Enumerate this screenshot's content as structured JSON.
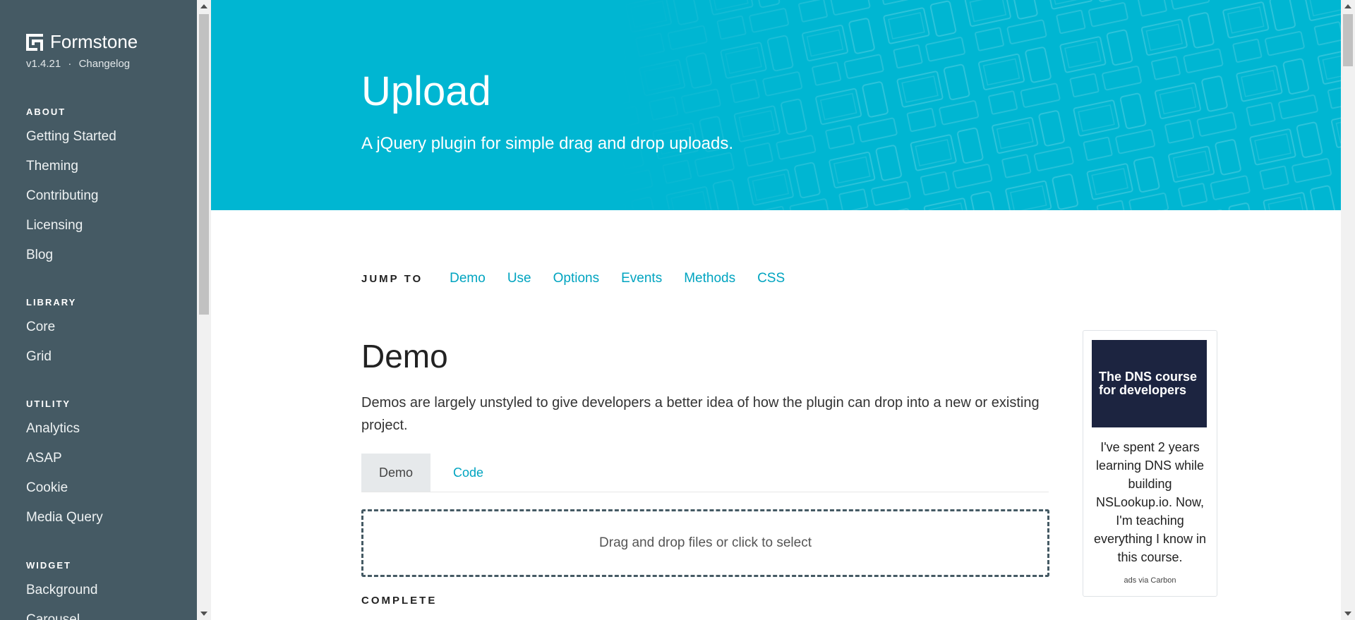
{
  "sidebar": {
    "brand": "Formstone",
    "version": "v1.4.21",
    "separator": "·",
    "changelog": "Changelog",
    "sections": [
      {
        "heading": "ABOUT",
        "items": [
          "Getting Started",
          "Theming",
          "Contributing",
          "Licensing",
          "Blog"
        ]
      },
      {
        "heading": "LIBRARY",
        "items": [
          "Core",
          "Grid"
        ]
      },
      {
        "heading": "UTILITY",
        "items": [
          "Analytics",
          "ASAP",
          "Cookie",
          "Media Query"
        ]
      },
      {
        "heading": "WIDGET",
        "items": [
          "Background",
          "Carousel"
        ]
      }
    ]
  },
  "hero": {
    "title": "Upload",
    "subtitle": "A jQuery plugin for simple drag and drop uploads."
  },
  "jump": {
    "label": "JUMP TO",
    "links": [
      "Demo",
      "Use",
      "Options",
      "Events",
      "Methods",
      "CSS"
    ]
  },
  "demo": {
    "title": "Demo",
    "description": "Demos are largely unstyled to give developers a better idea of how the plugin can drop into a new or existing project.",
    "tabs": [
      "Demo",
      "Code"
    ],
    "dropzone": "Drag and drop files or click to select",
    "complete_label": "COMPLETE"
  },
  "ad": {
    "image_text": "The DNS course for developers",
    "text": "I've spent 2 years learning DNS while building NSLookup.io. Now, I'm teaching everything I know in this course.",
    "via": "ads via Carbon"
  },
  "colors": {
    "sidebar_bg": "#455a64",
    "hero_bg": "#00b6d2",
    "link": "#00a4c0",
    "ad_image_bg": "#1c2440"
  }
}
